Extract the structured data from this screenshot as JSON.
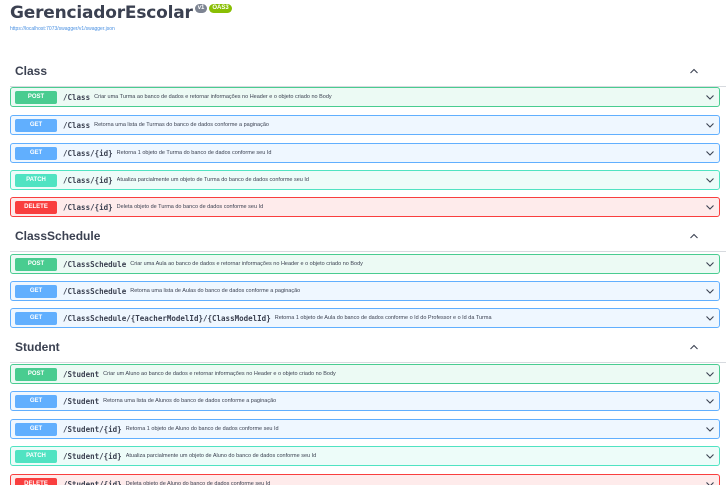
{
  "info": {
    "title": "GerenciadorEscolar",
    "version": "v1",
    "oas": "OAS3",
    "spec_url": "https://localhost:7073/swagger/v1/swagger.json"
  },
  "tags": [
    {
      "name": "Class",
      "operations": [
        {
          "method": "POST",
          "path": "/Class",
          "description": "Criar uma Turma ao banco de dados e retornar informações no Header e o objeto criado no Body"
        },
        {
          "method": "GET",
          "path": "/Class",
          "description": "Retorna uma lista de Turmas do banco de dados conforme a paginação"
        },
        {
          "method": "GET",
          "path": "/Class/{id}",
          "description": "Retorna 1 objeto de Turma do banco de dados conforme seu Id"
        },
        {
          "method": "PATCH",
          "path": "/Class/{id}",
          "description": "Atualiza parcialmente um objeto de Turma do banco de dados conforme seu Id"
        },
        {
          "method": "DELETE",
          "path": "/Class/{id}",
          "description": "Deleta objeto de Turma do banco de dados conforme seu Id"
        }
      ]
    },
    {
      "name": "ClassSchedule",
      "operations": [
        {
          "method": "POST",
          "path": "/ClassSchedule",
          "description": "Criar uma Aula ao banco de dados e retornar informações no Header e o objeto criado no Body"
        },
        {
          "method": "GET",
          "path": "/ClassSchedule",
          "description": "Retorna uma lista de Aulas do banco de dados conforme a paginação"
        },
        {
          "method": "GET",
          "path": "/ClassSchedule/{TeacherModelId}/{ClassModelId}",
          "description": "Retorna 1 objeto de Aula do banco de dados conforme o Id do Professor e o Id da Turma"
        }
      ]
    },
    {
      "name": "Student",
      "operations": [
        {
          "method": "POST",
          "path": "/Student",
          "description": "Criar um Aluno ao banco de dados e retornar informações no Header e o objeto criado no Body"
        },
        {
          "method": "GET",
          "path": "/Student",
          "description": "Retorna uma lista de Alunos do banco de dados conforme a paginação"
        },
        {
          "method": "GET",
          "path": "/Student/{id}",
          "description": "Retorna 1 objeto de Aluno do banco de dados conforme seu Id"
        },
        {
          "method": "PATCH",
          "path": "/Student/{id}",
          "description": "Atualiza parcialmente um objeto de Aluno do banco de dados conforme seu Id"
        },
        {
          "method": "DELETE",
          "path": "/Student/{id}",
          "description": "Deleta objeto de Aluno do banco de dados conforme seu Id"
        }
      ]
    }
  ]
}
